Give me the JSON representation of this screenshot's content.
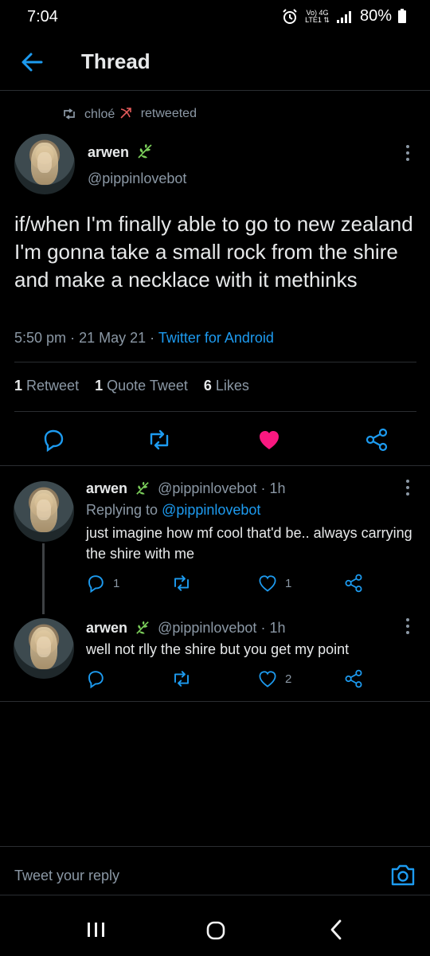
{
  "status": {
    "time": "7:04",
    "network_top": "Vo) 4G",
    "network_bottom": "LTE1 ⇅",
    "battery": "80%",
    "icons": [
      "alarm-icon",
      "signal-icon",
      "battery-icon"
    ]
  },
  "header": {
    "title": "Thread",
    "back_icon": "back-arrow-icon"
  },
  "retweet_notice": {
    "user": "chloé",
    "action": "retweeted",
    "icon": "retweet-icon"
  },
  "main_tweet": {
    "name": "arwen",
    "name_icon": "leaf-icon",
    "handle": "@pippinlovebot",
    "text": "if/when I'm finally able to go to new zealand I'm gonna take a small rock from the shire and make a necklace with it methinks",
    "time": "5:50 pm",
    "date": "21 May 21",
    "source": "Twitter for Android",
    "stats": {
      "retweets": "1",
      "retweets_label": "Retweet",
      "quotes": "1",
      "quotes_label": "Quote Tweet",
      "likes": "6",
      "likes_label": "Likes"
    },
    "liked": true
  },
  "replies": [
    {
      "name": "arwen",
      "handle": "@pippinlovebot",
      "age": "1h",
      "replying_to_label": "Replying to",
      "replying_to": "@pippinlovebot",
      "text": "just imagine how mf cool that'd be.. always carrying the shire with me",
      "reply_count": "1",
      "like_count": "1"
    },
    {
      "name": "arwen",
      "handle": "@pippinlovebot",
      "age": "1h",
      "text": "well not rlly the shire but you get my point",
      "like_count": "2"
    }
  ],
  "compose": {
    "placeholder": "Tweet your reply",
    "camera_icon": "camera-icon"
  },
  "colors": {
    "background": "#000000",
    "link": "#1d9bf0",
    "like": "#f91880",
    "muted": "#8b98a5"
  }
}
